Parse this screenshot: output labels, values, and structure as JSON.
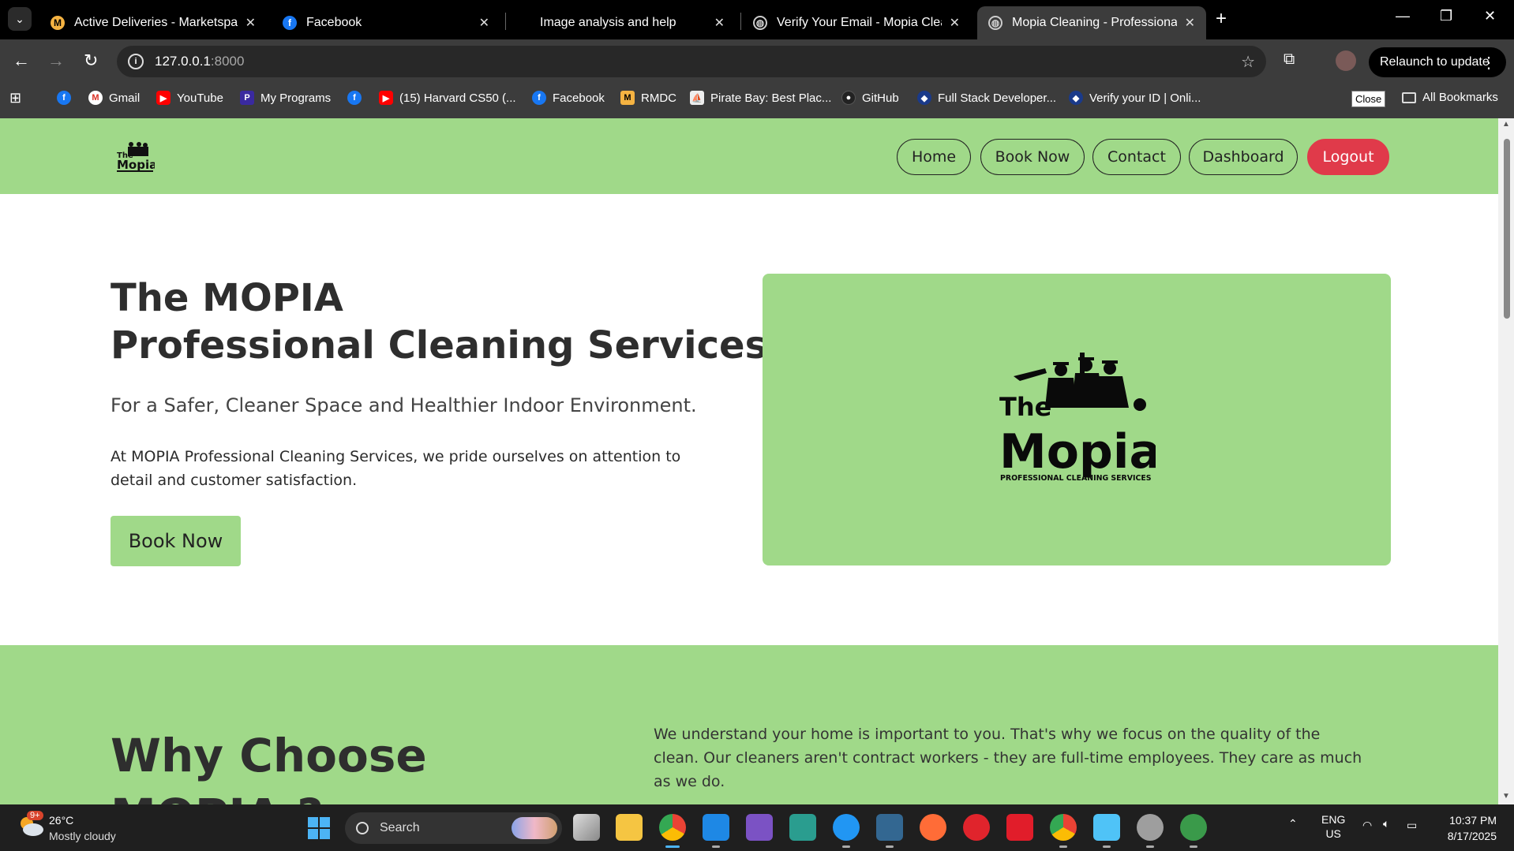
{
  "browser": {
    "tabs": [
      {
        "title": "Active Deliveries - MarketspaZe",
        "active": false
      },
      {
        "title": "Facebook",
        "active": false
      },
      {
        "title": "Image analysis and help",
        "active": false
      },
      {
        "title": "Verify Your Email - Mopia Clean",
        "active": false
      },
      {
        "title": "Mopia Cleaning - Professional C",
        "active": true
      }
    ],
    "url_host": "127.0.0.1",
    "url_port": ":8000",
    "relaunch_label": "Relaunch to update",
    "bookmarks": [
      {
        "label": "Gmail",
        "icon": "gmail-icon"
      },
      {
        "label": "YouTube",
        "icon": "youtube-icon"
      },
      {
        "label": "My Programs",
        "icon": "programs-icon"
      },
      {
        "label": "",
        "icon": "facebook-icon"
      },
      {
        "label": "(15) Harvard CS50 (...",
        "icon": "youtube-icon"
      },
      {
        "label": "Facebook",
        "icon": "facebook-icon"
      },
      {
        "label": "RMDC",
        "icon": "rmdc-icon"
      },
      {
        "label": "Pirate Bay: Best Plac...",
        "icon": "piratebay-icon"
      },
      {
        "label": "GitHub",
        "icon": "github-icon"
      },
      {
        "label": "Full Stack Developer...",
        "icon": "fullstack-icon"
      },
      {
        "label": "Verify your ID | Onli...",
        "icon": "verify-icon"
      }
    ],
    "close_tooltip": "Close",
    "all_bookmarks_label": "All Bookmarks"
  },
  "site": {
    "nav": {
      "home": "Home",
      "book_now": "Book Now",
      "contact": "Contact",
      "dashboard": "Dashboard",
      "logout": "Logout"
    },
    "hero": {
      "title_line1": "The MOPIA",
      "title_line2": "Professional Cleaning Services",
      "subtitle": "For a Safer, Cleaner Space and Healthier Indoor Environment.",
      "text": "At MOPIA Professional Cleaning Services, we pride ourselves on attention to detail and customer satisfaction.",
      "cta": "Book Now"
    },
    "logo": {
      "word1": "The",
      "word2": "Mopia",
      "tagline": "PROFESSIONAL CLEANING SERVICES"
    },
    "why": {
      "title_line1": "Why Choose",
      "title_line2": "MOPIA ?",
      "text": "We understand your home is important to you. That's why we focus on the quality of the clean. Our cleaners aren't contract workers - they are full-time employees. They care as much as we do."
    },
    "colors": {
      "brand_green": "#a0d989",
      "logout_red": "#e03a4a"
    }
  },
  "taskbar": {
    "weather_badge": "9+",
    "temperature": "26°C",
    "condition": "Mostly cloudy",
    "search_label": "Search",
    "lang": "ENG",
    "region": "US",
    "time": "10:37 PM",
    "date": "8/17/2025"
  }
}
